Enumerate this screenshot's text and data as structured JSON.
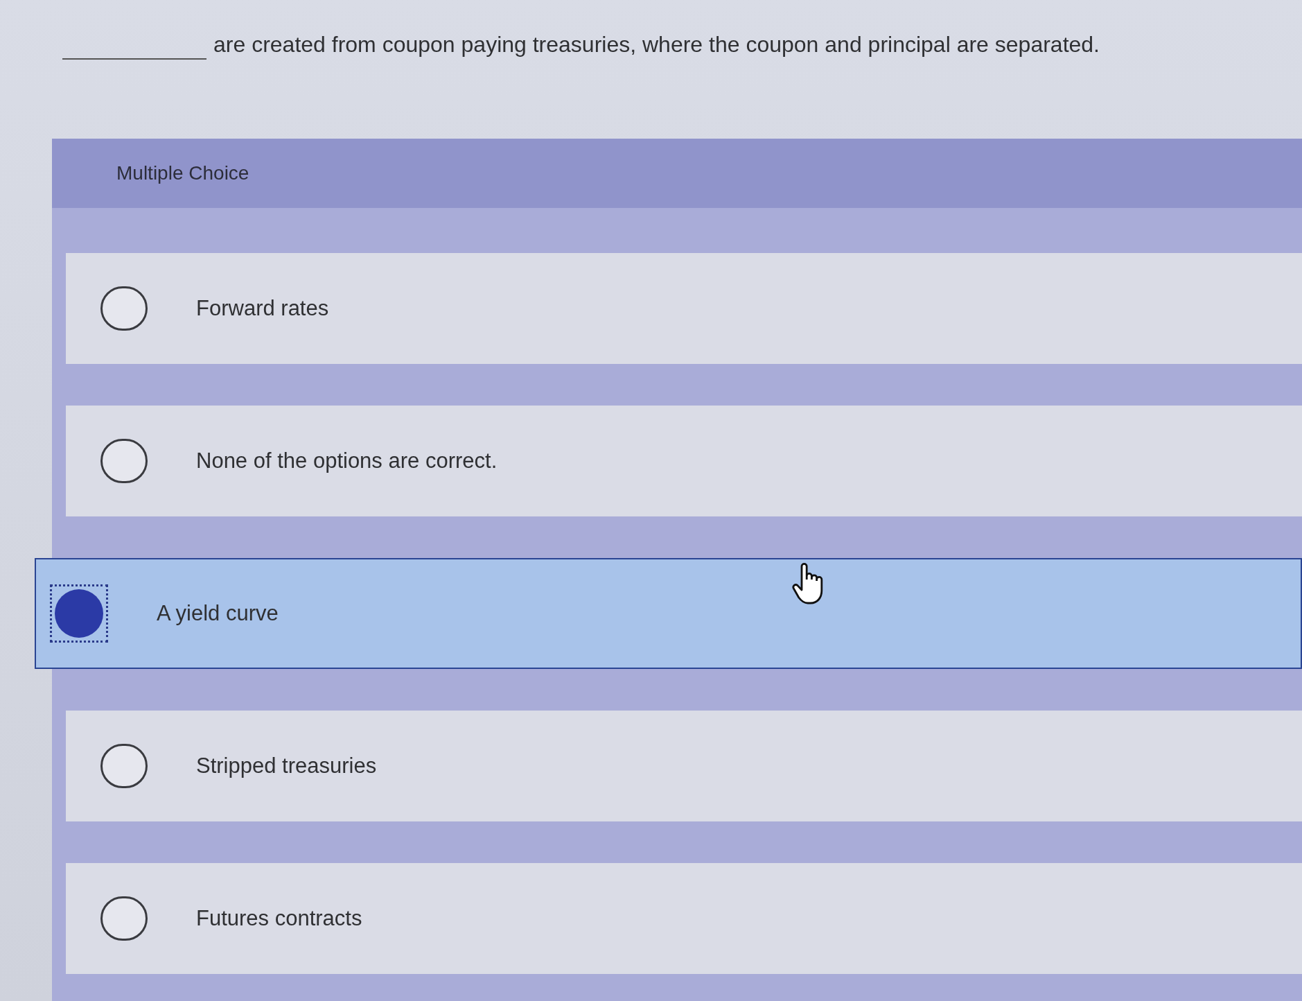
{
  "question": {
    "text": "are created from coupon paying treasuries, where the coupon and principal are separated."
  },
  "panel": {
    "title": "Multiple Choice"
  },
  "options": [
    {
      "label": "Forward rates",
      "selected": false
    },
    {
      "label": "None of the options are correct.",
      "selected": false
    },
    {
      "label": "A yield curve",
      "selected": true
    },
    {
      "label": "Stripped treasuries",
      "selected": false
    },
    {
      "label": "Futures contracts",
      "selected": false
    }
  ]
}
